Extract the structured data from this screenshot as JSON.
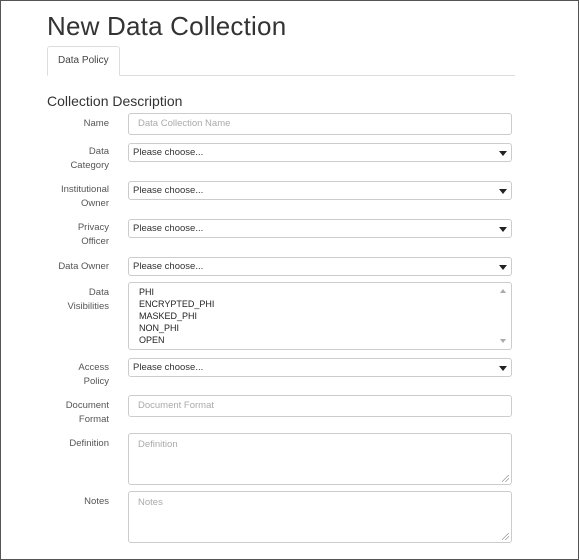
{
  "page": {
    "title": "New Data Collection"
  },
  "tabs": [
    {
      "label": "Data Policy"
    }
  ],
  "section": {
    "title": "Collection Description"
  },
  "form": {
    "name": {
      "label": "Name",
      "placeholder": "Data Collection Name"
    },
    "data_category": {
      "label_line1": "Data",
      "label_line2": "Category",
      "value": "Please choose..."
    },
    "institutional_owner": {
      "label_line1": "Institutional",
      "label_line2": "Owner",
      "value": "Please choose..."
    },
    "privacy_officer": {
      "label_line1": "Privacy",
      "label_line2": "Officer",
      "value": "Please choose..."
    },
    "data_owner": {
      "label": "Data Owner",
      "value": "Please choose..."
    },
    "data_visibilities": {
      "label_line1": "Data",
      "label_line2": "Visibilities",
      "options": [
        "PHI",
        "ENCRYPTED_PHI",
        "MASKED_PHI",
        "NON_PHI",
        "OPEN"
      ]
    },
    "access_policy": {
      "label_line1": "Access",
      "label_line2": "Policy",
      "value": "Please choose..."
    },
    "document_format": {
      "label_line1": "Document",
      "label_line2": "Format",
      "placeholder": "Document Format"
    },
    "definition": {
      "label": "Definition",
      "placeholder": "Definition"
    },
    "notes": {
      "label": "Notes",
      "placeholder": "Notes"
    }
  }
}
